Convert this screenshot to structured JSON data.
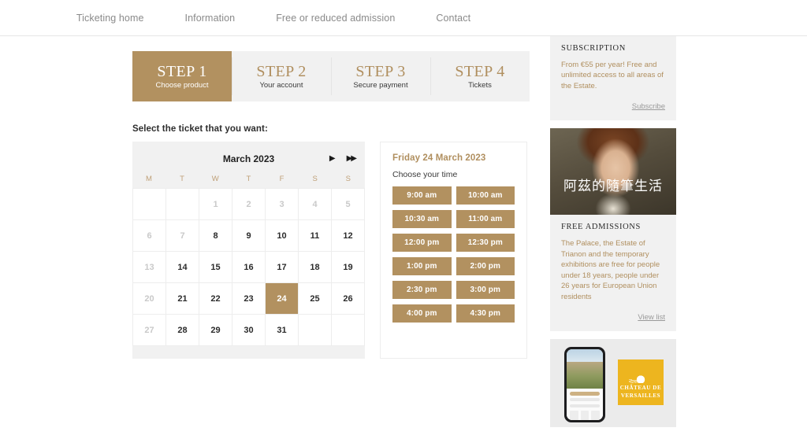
{
  "nav": {
    "items": [
      {
        "label": "Ticketing home"
      },
      {
        "label": "Information"
      },
      {
        "label": "Free or reduced admission"
      },
      {
        "label": "Contact"
      }
    ]
  },
  "steps": [
    {
      "big": "STEP 1",
      "sub": "Choose product",
      "active": true
    },
    {
      "big": "STEP 2",
      "sub": "Your account",
      "active": false
    },
    {
      "big": "STEP 3",
      "sub": "Secure payment",
      "active": false
    },
    {
      "big": "STEP 4",
      "sub": "Tickets",
      "active": false
    }
  ],
  "main": {
    "select_label": "Select the ticket that you want:"
  },
  "calendar": {
    "title": "March 2023",
    "next_icon": "▶",
    "next_year_icon": "▶▶",
    "dow": [
      "M",
      "T",
      "W",
      "T",
      "F",
      "S",
      "S"
    ],
    "weeks": [
      [
        {
          "d": "",
          "state": "empty"
        },
        {
          "d": "",
          "state": "empty"
        },
        {
          "d": "1",
          "state": "muted"
        },
        {
          "d": "2",
          "state": "muted"
        },
        {
          "d": "3",
          "state": "muted"
        },
        {
          "d": "4",
          "state": "muted"
        },
        {
          "d": "5",
          "state": "muted"
        }
      ],
      [
        {
          "d": "6",
          "state": "muted"
        },
        {
          "d": "7",
          "state": "muted"
        },
        {
          "d": "8",
          "state": "on"
        },
        {
          "d": "9",
          "state": "on"
        },
        {
          "d": "10",
          "state": "on"
        },
        {
          "d": "11",
          "state": "on"
        },
        {
          "d": "12",
          "state": "on"
        }
      ],
      [
        {
          "d": "13",
          "state": "muted"
        },
        {
          "d": "14",
          "state": "on"
        },
        {
          "d": "15",
          "state": "on"
        },
        {
          "d": "16",
          "state": "on"
        },
        {
          "d": "17",
          "state": "on"
        },
        {
          "d": "18",
          "state": "on"
        },
        {
          "d": "19",
          "state": "on"
        }
      ],
      [
        {
          "d": "20",
          "state": "muted"
        },
        {
          "d": "21",
          "state": "on"
        },
        {
          "d": "22",
          "state": "on"
        },
        {
          "d": "23",
          "state": "on"
        },
        {
          "d": "24",
          "state": "sel"
        },
        {
          "d": "25",
          "state": "on"
        },
        {
          "d": "26",
          "state": "on"
        }
      ],
      [
        {
          "d": "27",
          "state": "muted"
        },
        {
          "d": "28",
          "state": "on"
        },
        {
          "d": "29",
          "state": "on"
        },
        {
          "d": "30",
          "state": "on"
        },
        {
          "d": "31",
          "state": "on"
        },
        {
          "d": "",
          "state": "empty"
        },
        {
          "d": "",
          "state": "empty"
        }
      ]
    ]
  },
  "times": {
    "date": "Friday 24 March 2023",
    "hint": "Choose your time",
    "slots": [
      "9:00 am",
      "10:00 am",
      "10:30 am",
      "11:00 am",
      "12:00 pm",
      "12:30 pm",
      "1:00 pm",
      "2:00 pm",
      "2:30 pm",
      "3:00 pm",
      "4:00 pm",
      "4:30 pm"
    ]
  },
  "rail": {
    "subscription": {
      "title": "SUBSCRIPTION",
      "body": "From €55 per year!\nFree and unlimited access to all areas of the Estate.",
      "link": "Subscribe"
    },
    "portrait": {
      "watermark": "阿茲的隨筆生活"
    },
    "free_admissions": {
      "title": "FREE ADMISSIONS",
      "body": "The Palace, the Estate of Trianon and the temporary exhibitions are free for people under 18 years, people under 26 years for European Union residents",
      "link": "View list"
    },
    "promo": {
      "logo_line1": "CHÂTEAU DE",
      "logo_line2": "VERSAILLES"
    }
  },
  "colors": {
    "gold": "#b29160",
    "gold_text": "#b08f5f",
    "panel": "#f1f1f1",
    "yellow": "#edb51f"
  }
}
